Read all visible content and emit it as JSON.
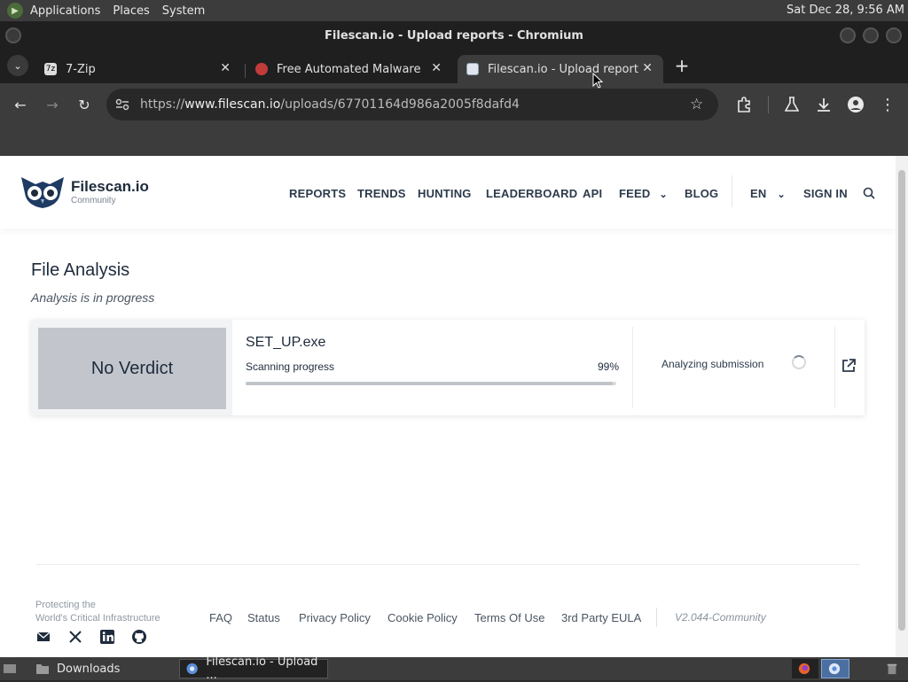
{
  "desktop": {
    "menus": [
      "Applications",
      "Places",
      "System"
    ],
    "clock": "Sat Dec 28,  9:56 AM"
  },
  "window": {
    "title": "Filescan.io - Upload reports - Chromium"
  },
  "tabs": [
    {
      "label": "7-Zip",
      "favicon": "7z"
    },
    {
      "label": "Free Automated Malware Analysis",
      "favicon": ""
    },
    {
      "label": "Filescan.io - Upload reports",
      "favicon": ""
    }
  ],
  "omnibox": {
    "scheme": "https://",
    "host": "www.filescan.io",
    "path": "/uploads/67701164d986a2005f8dafd4"
  },
  "site": {
    "brand": "Filescan.io",
    "brand_sub": "Community",
    "nav": {
      "reports": "REPORTS",
      "trends": "TRENDS",
      "hunting": "HUNTING",
      "leaderboard": "LEADERBOARD",
      "api": "API",
      "feed": "FEED",
      "blog": "BLOG",
      "lang": "EN",
      "signin": "SIGN IN"
    }
  },
  "main": {
    "title": "File Analysis",
    "subtitle": "Analysis is in progress",
    "result": {
      "verdict": "No Verdict",
      "file_name": "SET_UP.exe",
      "progress_label": "Scanning progress",
      "progress_text": "99%",
      "progress": 0.99,
      "status": "Analyzing submission"
    }
  },
  "footer": {
    "tagline_1": "Protecting the",
    "tagline_2": "World's Critical Infrastructure",
    "links": {
      "faq": "FAQ",
      "status": "Status",
      "privacy": "Privacy Policy",
      "cookie": "Cookie Policy",
      "terms": "Terms Of Use",
      "eula": "3rd Party EULA"
    },
    "version": "V2.044-Community"
  },
  "taskbar": {
    "items": [
      "Downloads",
      "Filescan.io - Upload ..."
    ]
  },
  "colors": {
    "brand_dark": "#1e2b3c",
    "verdict_bg": "#c2c6cc",
    "chrome_dark": "#1f1f1f"
  }
}
